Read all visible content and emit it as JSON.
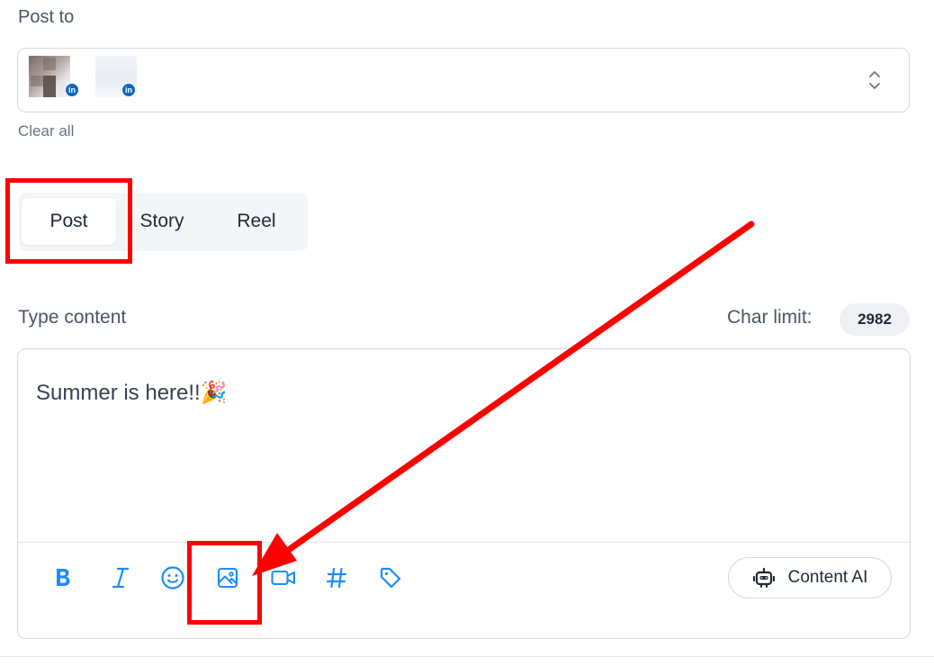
{
  "post_to": {
    "label": "Post to",
    "accounts": [
      {
        "network": "linkedin",
        "badge": "in"
      },
      {
        "network": "linkedin",
        "badge": "in"
      }
    ],
    "clear_all": "Clear all"
  },
  "post_types": {
    "tabs": [
      {
        "label": "Post",
        "selected": true
      },
      {
        "label": "Story",
        "selected": false
      },
      {
        "label": "Reel",
        "selected": false
      }
    ]
  },
  "content": {
    "label": "Type content",
    "char_limit_label": "Char limit:",
    "char_limit_value": "2982",
    "text": "Summer is here!!",
    "emoji": "🎉"
  },
  "toolbar": {
    "tools": [
      "bold-icon",
      "italic-icon",
      "emoji-icon",
      "image-icon",
      "video-icon",
      "hashtag-icon",
      "tag-icon"
    ],
    "content_ai_label": "Content AI"
  },
  "colors": {
    "accent": "#1a8cff",
    "annotation": "#ff0000",
    "linkedin": "#0a66c2"
  }
}
